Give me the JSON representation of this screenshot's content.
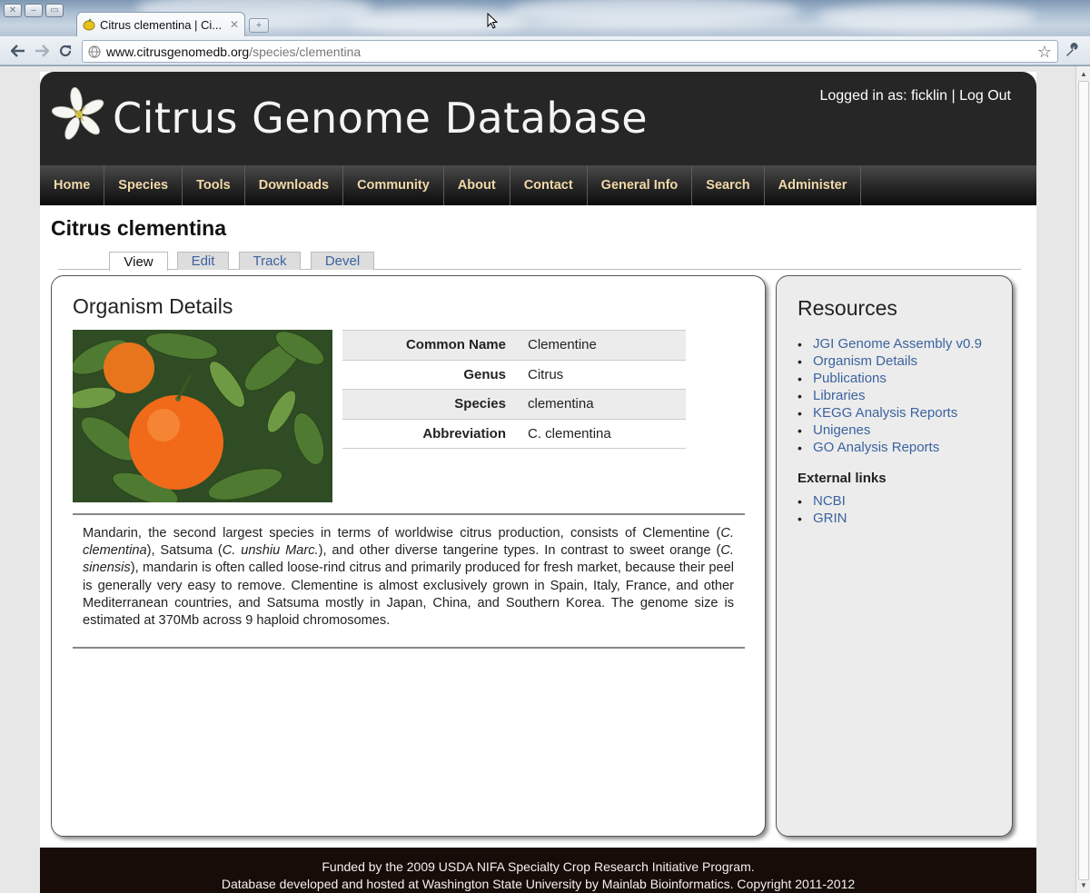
{
  "browser": {
    "tab_title": "Citrus clementina | Ci...",
    "url_host": "www.citrusgenomedb.org",
    "url_path": "/species/clementina"
  },
  "header": {
    "site_title": "Citrus Genome Database",
    "login_text": "Logged in as: ficklin | Log Out"
  },
  "nav": [
    "Home",
    "Species",
    "Tools",
    "Downloads",
    "Community",
    "About",
    "Contact",
    "General Info",
    "Search",
    "Administer"
  ],
  "page": {
    "title": "Citrus clementina",
    "tabs": [
      "View",
      "Edit",
      "Track",
      "Devel"
    ],
    "active_tab": "View"
  },
  "organism": {
    "section_title": "Organism Details",
    "rows": [
      {
        "label": "Common Name",
        "value": "Clementine"
      },
      {
        "label": "Genus",
        "value": "Citrus"
      },
      {
        "label": "Species",
        "value": "clementina"
      },
      {
        "label": "Abbreviation",
        "value": "C. clementina"
      }
    ],
    "description": [
      {
        "t": "Mandarin, the second largest species in terms of worldwise citrus production, consists of Clementine (",
        "i": false
      },
      {
        "t": "C. clementina",
        "i": true
      },
      {
        "t": "), Satsuma (",
        "i": false
      },
      {
        "t": "C. unshiu Marc.",
        "i": true
      },
      {
        "t": "), and other diverse tangerine types. In contrast to sweet orange (",
        "i": false
      },
      {
        "t": "C. sinensis",
        "i": true
      },
      {
        "t": "), mandarin is often called loose-rind citrus and primarily produced for fresh market, because their peel is generally very easy to remove. Clementine is almost exclusively grown in Spain, Italy, France, and other Mediterranean countries, and Satsuma mostly in Japan, China, and Southern Korea.  The genome size is estimated at 370Mb across 9 haploid chromosomes.",
        "i": false
      }
    ]
  },
  "sidebar": {
    "title": "Resources",
    "resources": [
      "JGI Genome Assembly v0.9",
      "Organism Details",
      "Publications",
      "Libraries",
      "KEGG Analysis Reports",
      "Unigenes",
      "GO Analysis Reports"
    ],
    "external_title": "External links",
    "external": [
      "NCBI",
      "GRIN"
    ]
  },
  "footer": {
    "line1": "Funded by the 2009 USDA NIFA Specialty Crop Research Initiative Program.",
    "line2": "Database developed and  hosted at Washington State University  by Mainlab Bioinformatics. Copyright 2011-2012"
  },
  "colors": {
    "header_bg": "#262626",
    "nav_text": "#f0d9a8",
    "link": "#3b63a0",
    "footer_bg": "#180c08"
  }
}
